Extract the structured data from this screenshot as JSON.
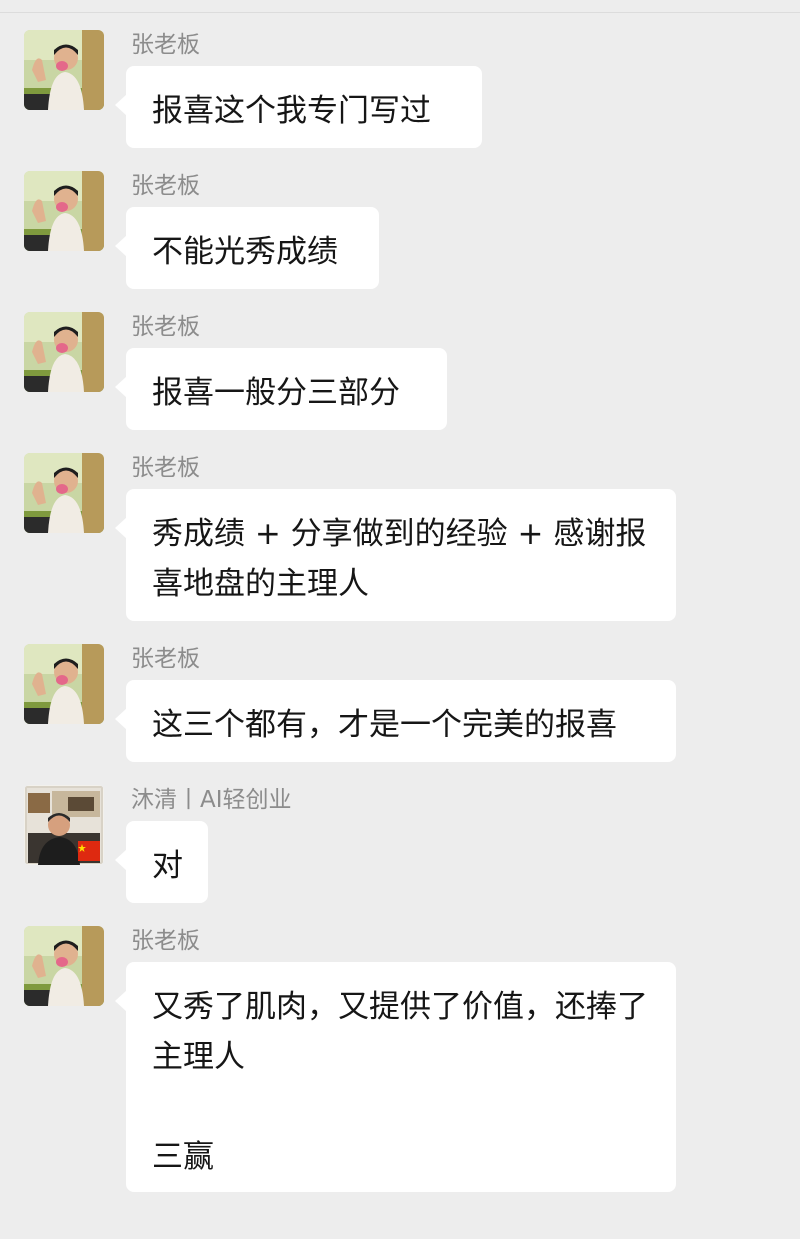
{
  "messages": [
    {
      "sender": "张老板",
      "avatar": "boss-avatar",
      "text": "报喜这个我专门写过"
    },
    {
      "sender": "张老板",
      "avatar": "boss-avatar",
      "text": "不能光秀成绩"
    },
    {
      "sender": "张老板",
      "avatar": "boss-avatar",
      "text": "报喜一般分三部分"
    },
    {
      "sender": "张老板",
      "avatar": "boss-avatar",
      "text": "秀成绩 + 分享做到的经验 + 感谢报喜地盘的主理人"
    },
    {
      "sender": "张老板",
      "avatar": "boss-avatar",
      "text": "这三个都有，才是一个完美的报喜"
    },
    {
      "sender": "沐清丨AI轻创业",
      "avatar": "muqing-avatar",
      "text": "对"
    },
    {
      "sender": "张老板",
      "avatar": "boss-avatar",
      "text": "又秀了肌肉，又提供了价值，还捧了主理人\n\n三赢"
    }
  ],
  "colors": {
    "background": "#ededed",
    "bubble": "#ffffff",
    "sender_name": "#8c8c8c",
    "message_text": "#161616"
  }
}
